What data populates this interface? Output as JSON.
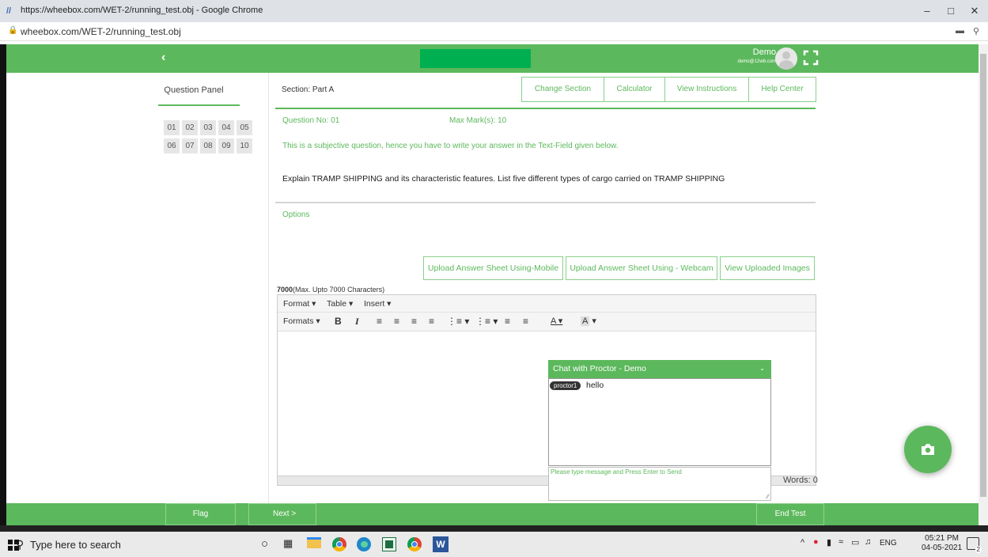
{
  "browser": {
    "title": "https://wheebox.com/WET-2/running_test.obj - Google Chrome",
    "url": "wheebox.com/WET-2/running_test.obj"
  },
  "header": {
    "user_name": "Demo",
    "user_email": "demo@12wb.com",
    "brand_color": "#5cb85c"
  },
  "question_panel": {
    "title": "Question Panel",
    "numbers": [
      "01",
      "02",
      "03",
      "04",
      "05",
      "06",
      "07",
      "08",
      "09",
      "10"
    ]
  },
  "section": {
    "label": "Section: Part A",
    "buttons": [
      "Change Section",
      "Calculator",
      "View Instructions",
      "Help Center"
    ]
  },
  "question": {
    "number_label": "Question No: 01",
    "max_marks": "Max Mark(s): 10",
    "hint": "This is a subjective question, hence you have to write your answer in the Text-Field given below.",
    "text": "Explain TRAMP SHIPPING and its characteristic features. List five different types of cargo carried on TRAMP SHIPPING",
    "options_label": "Options"
  },
  "upload": {
    "mobile": "Upload Answer Sheet Using-Mobile",
    "webcam": "Upload Answer Sheet Using - Webcam",
    "view": "View Uploaded Images"
  },
  "editor": {
    "char_count": "7000",
    "char_limit": "(Max. Upto 7000 Characters)",
    "menu": [
      "Format",
      "Table",
      "Insert"
    ],
    "formats_label": "Formats",
    "words_label": "Words: 0"
  },
  "chat": {
    "title": "Chat with Proctor - Demo",
    "sender": "proctor1",
    "message": "hello",
    "placeholder": "Please type message and Press Enter to Send"
  },
  "footer": {
    "flag": "Flag",
    "next": "Next >",
    "end": "End Test"
  },
  "taskbar": {
    "search_placeholder": "Type here to search",
    "language": "ENG",
    "time": "05:21 PM",
    "date": "04-05-2021",
    "notification_count": "2"
  }
}
